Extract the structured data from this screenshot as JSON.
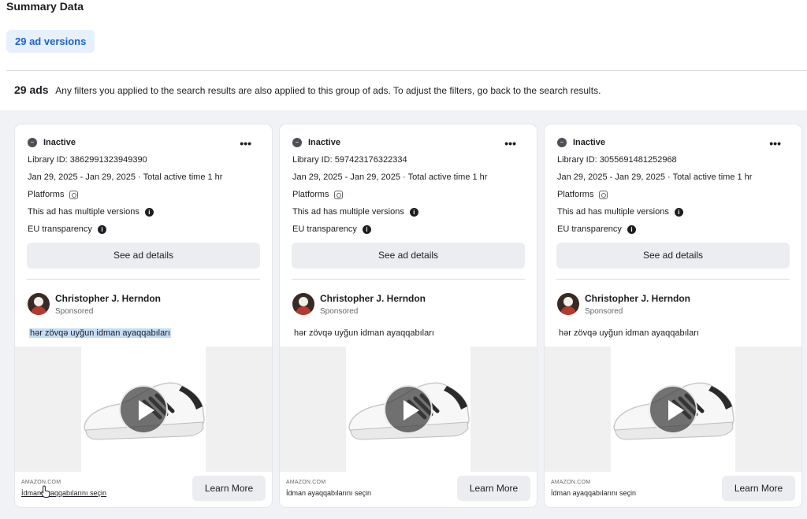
{
  "header": {
    "title": "Summary Data",
    "versions_chip": "29 ad versions",
    "ads_count": "29 ads",
    "ads_description": "Any filters you applied to the search results are also applied to this group of ads. To adjust the filters, go back to the search results."
  },
  "common": {
    "platforms_label": "Platforms",
    "multiple_versions_label": "This ad has multiple versions",
    "eu_transparency_label": "EU transparency",
    "see_details_label": "See ad details",
    "sponsored_label": "Sponsored",
    "learn_more_label": "Learn More"
  },
  "cards": [
    {
      "status": "Inactive",
      "library_id": "Library ID: 3862991323949390",
      "dates": "Jan 29, 2025 - Jan 29, 2025 · Total active time 1 hr",
      "advertiser": "Christopher J. Herndon",
      "ad_text": "hər zövqə uyğun idman ayaqqabıları",
      "domain": "AMAZON.COM",
      "cta_caption": "İdman ayaqqabılarını seçin"
    },
    {
      "status": "Inactive",
      "library_id": "Library ID: 597423176322334",
      "dates": "Jan 29, 2025 - Jan 29, 2025 · Total active time 1 hr",
      "advertiser": "Christopher J. Herndon",
      "ad_text": "hər zövqə uyğun idman ayaqqabıları",
      "domain": "AMAZON.COM",
      "cta_caption": "İdman ayaqqabılarını seçin"
    },
    {
      "status": "Inactive",
      "library_id": "Library ID: 3055691481252968",
      "dates": "Jan 29, 2025 - Jan 29, 2025 · Total active time 1 hr",
      "advertiser": "Christopher J. Herndon",
      "ad_text": "hər zövqə uyğun idman ayaqqabıları",
      "domain": "AMAZON.COM",
      "cta_caption": "İdman ayaqqabılarını seçin"
    }
  ],
  "icons": {
    "status": "inactive-status-icon",
    "more": "more-options-icon",
    "info": "info-icon",
    "platform": "instagram-icon",
    "play": "play-icon",
    "cursor": "hand-pointer-icon"
  },
  "colors": {
    "chip_bg": "#e7f0fd",
    "chip_text": "#1b62d6",
    "page_bg": "#f0f2f5",
    "button_bg": "#ebedf0",
    "highlight": "#c4dcf7"
  }
}
